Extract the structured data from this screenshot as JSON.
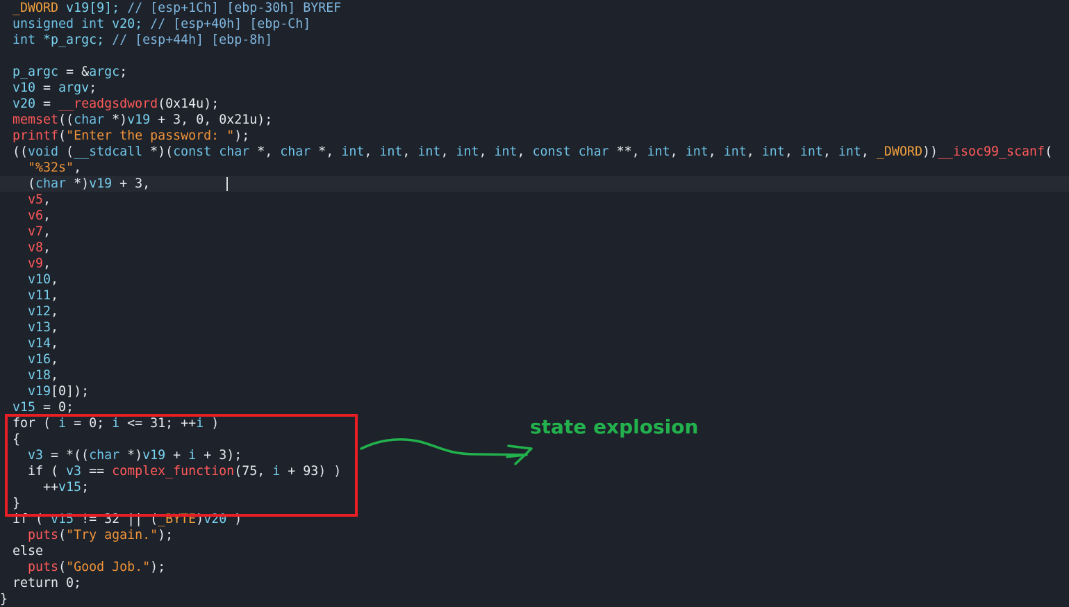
{
  "colors": {
    "background": "#1e222a",
    "highlight_box": "#e81e25",
    "annotation": "#22b14c"
  },
  "lines": [
    {
      "tokens": [
        {
          "t": "_DWORD",
          "c": "glob"
        },
        {
          "t": " v19[9]; ",
          "c": "var"
        },
        {
          "t": "// [esp+1Ch] [ebp-30h] BYREF",
          "c": "com"
        }
      ]
    },
    {
      "tokens": [
        {
          "t": "unsigned int",
          "c": "type"
        },
        {
          "t": " v20; ",
          "c": "var"
        },
        {
          "t": "// [esp+40h] [ebp-Ch]",
          "c": "com"
        }
      ]
    },
    {
      "tokens": [
        {
          "t": "int",
          "c": "type"
        },
        {
          "t": " *p_argc; ",
          "c": "var"
        },
        {
          "t": "// [esp+44h] [ebp-8h]",
          "c": "com"
        }
      ]
    },
    {
      "tokens": []
    },
    {
      "tokens": [
        {
          "t": "p_argc",
          "c": "var"
        },
        {
          "t": " = &",
          "c": "plain"
        },
        {
          "t": "argc",
          "c": "var"
        },
        {
          "t": ";",
          "c": "plain"
        }
      ]
    },
    {
      "tokens": [
        {
          "t": "v10",
          "c": "var"
        },
        {
          "t": " = ",
          "c": "plain"
        },
        {
          "t": "argv",
          "c": "var"
        },
        {
          "t": ";",
          "c": "plain"
        }
      ]
    },
    {
      "tokens": [
        {
          "t": "v20",
          "c": "var"
        },
        {
          "t": " = ",
          "c": "plain"
        },
        {
          "t": "__readgsdword",
          "c": "func"
        },
        {
          "t": "(0x14u);",
          "c": "plain"
        }
      ]
    },
    {
      "tokens": [
        {
          "t": "memset",
          "c": "func"
        },
        {
          "t": "((",
          "c": "plain"
        },
        {
          "t": "char",
          "c": "type"
        },
        {
          "t": " *)",
          "c": "plain"
        },
        {
          "t": "v19",
          "c": "var"
        },
        {
          "t": " + 3, 0, 0x21u);",
          "c": "plain"
        }
      ]
    },
    {
      "tokens": [
        {
          "t": "printf",
          "c": "func"
        },
        {
          "t": "(",
          "c": "plain"
        },
        {
          "t": "\"Enter the password: \"",
          "c": "str"
        },
        {
          "t": ");",
          "c": "plain"
        }
      ]
    },
    {
      "tokens": [
        {
          "t": "((",
          "c": "plain"
        },
        {
          "t": "void",
          "c": "type"
        },
        {
          "t": " (",
          "c": "plain"
        },
        {
          "t": "__stdcall",
          "c": "type"
        },
        {
          "t": " *)(",
          "c": "plain"
        },
        {
          "t": "const char",
          "c": "type"
        },
        {
          "t": " *, ",
          "c": "plain"
        },
        {
          "t": "char",
          "c": "type"
        },
        {
          "t": " *, ",
          "c": "plain"
        },
        {
          "t": "int",
          "c": "type"
        },
        {
          "t": ", ",
          "c": "plain"
        },
        {
          "t": "int",
          "c": "type"
        },
        {
          "t": ", ",
          "c": "plain"
        },
        {
          "t": "int",
          "c": "type"
        },
        {
          "t": ", ",
          "c": "plain"
        },
        {
          "t": "int",
          "c": "type"
        },
        {
          "t": ", ",
          "c": "plain"
        },
        {
          "t": "int",
          "c": "type"
        },
        {
          "t": ", ",
          "c": "plain"
        },
        {
          "t": "const char",
          "c": "type"
        },
        {
          "t": " **, ",
          "c": "plain"
        },
        {
          "t": "int",
          "c": "type"
        },
        {
          "t": ", ",
          "c": "plain"
        },
        {
          "t": "int",
          "c": "type"
        },
        {
          "t": ", ",
          "c": "plain"
        },
        {
          "t": "int",
          "c": "type"
        },
        {
          "t": ", ",
          "c": "plain"
        },
        {
          "t": "int",
          "c": "type"
        },
        {
          "t": ", ",
          "c": "plain"
        },
        {
          "t": "int",
          "c": "type"
        },
        {
          "t": ", ",
          "c": "plain"
        },
        {
          "t": "int",
          "c": "type"
        },
        {
          "t": ", ",
          "c": "plain"
        },
        {
          "t": "_DWORD",
          "c": "glob"
        },
        {
          "t": "))",
          "c": "plain"
        },
        {
          "t": "__isoc99_scanf",
          "c": "func"
        },
        {
          "t": "(",
          "c": "plain"
        }
      ]
    },
    {
      "tokens": [
        {
          "t": "  ",
          "c": "plain"
        },
        {
          "t": "\"%32s\"",
          "c": "str"
        },
        {
          "t": ",",
          "c": "plain"
        }
      ]
    },
    {
      "current": true,
      "tokens": [
        {
          "t": "  (",
          "c": "plain"
        },
        {
          "t": "char",
          "c": "type"
        },
        {
          "t": " *)",
          "c": "plain"
        },
        {
          "t": "v19",
          "c": "var"
        },
        {
          "t": " + 3,",
          "c": "plain"
        }
      ]
    },
    {
      "tokens": [
        {
          "t": "  ",
          "c": "plain"
        },
        {
          "t": "v5",
          "c": "arg"
        },
        {
          "t": ",",
          "c": "plain"
        }
      ]
    },
    {
      "tokens": [
        {
          "t": "  ",
          "c": "plain"
        },
        {
          "t": "v6",
          "c": "arg"
        },
        {
          "t": ",",
          "c": "plain"
        }
      ]
    },
    {
      "tokens": [
        {
          "t": "  ",
          "c": "plain"
        },
        {
          "t": "v7",
          "c": "arg"
        },
        {
          "t": ",",
          "c": "plain"
        }
      ]
    },
    {
      "tokens": [
        {
          "t": "  ",
          "c": "plain"
        },
        {
          "t": "v8",
          "c": "arg"
        },
        {
          "t": ",",
          "c": "plain"
        }
      ]
    },
    {
      "tokens": [
        {
          "t": "  ",
          "c": "plain"
        },
        {
          "t": "v9",
          "c": "arg"
        },
        {
          "t": ",",
          "c": "plain"
        }
      ]
    },
    {
      "tokens": [
        {
          "t": "  ",
          "c": "plain"
        },
        {
          "t": "v10",
          "c": "var"
        },
        {
          "t": ",",
          "c": "plain"
        }
      ]
    },
    {
      "tokens": [
        {
          "t": "  ",
          "c": "plain"
        },
        {
          "t": "v11",
          "c": "var"
        },
        {
          "t": ",",
          "c": "plain"
        }
      ]
    },
    {
      "tokens": [
        {
          "t": "  ",
          "c": "plain"
        },
        {
          "t": "v12",
          "c": "var"
        },
        {
          "t": ",",
          "c": "plain"
        }
      ]
    },
    {
      "tokens": [
        {
          "t": "  ",
          "c": "plain"
        },
        {
          "t": "v13",
          "c": "var"
        },
        {
          "t": ",",
          "c": "plain"
        }
      ]
    },
    {
      "tokens": [
        {
          "t": "  ",
          "c": "plain"
        },
        {
          "t": "v14",
          "c": "var"
        },
        {
          "t": ",",
          "c": "plain"
        }
      ]
    },
    {
      "tokens": [
        {
          "t": "  ",
          "c": "plain"
        },
        {
          "t": "v16",
          "c": "var"
        },
        {
          "t": ",",
          "c": "plain"
        }
      ]
    },
    {
      "tokens": [
        {
          "t": "  ",
          "c": "plain"
        },
        {
          "t": "v18",
          "c": "var"
        },
        {
          "t": ",",
          "c": "plain"
        }
      ]
    },
    {
      "tokens": [
        {
          "t": "  ",
          "c": "plain"
        },
        {
          "t": "v19",
          "c": "var"
        },
        {
          "t": "[0]);",
          "c": "plain"
        }
      ]
    },
    {
      "tokens": [
        {
          "t": "v15",
          "c": "var"
        },
        {
          "t": " = 0;",
          "c": "plain"
        }
      ]
    },
    {
      "tokens": [
        {
          "t": "for ( ",
          "c": "plain"
        },
        {
          "t": "i",
          "c": "var"
        },
        {
          "t": " = 0; ",
          "c": "plain"
        },
        {
          "t": "i",
          "c": "var"
        },
        {
          "t": " <= 31; ++",
          "c": "plain"
        },
        {
          "t": "i",
          "c": "var"
        },
        {
          "t": " )",
          "c": "plain"
        }
      ]
    },
    {
      "tokens": [
        {
          "t": "{",
          "c": "plain"
        }
      ]
    },
    {
      "tokens": [
        {
          "t": "  ",
          "c": "plain"
        },
        {
          "t": "v3",
          "c": "var"
        },
        {
          "t": " = *((",
          "c": "plain"
        },
        {
          "t": "char",
          "c": "type"
        },
        {
          "t": " *)",
          "c": "plain"
        },
        {
          "t": "v19",
          "c": "var"
        },
        {
          "t": " + ",
          "c": "plain"
        },
        {
          "t": "i",
          "c": "var"
        },
        {
          "t": " + 3);",
          "c": "plain"
        }
      ]
    },
    {
      "tokens": [
        {
          "t": "  if ( ",
          "c": "plain"
        },
        {
          "t": "v3",
          "c": "var"
        },
        {
          "t": " == ",
          "c": "plain"
        },
        {
          "t": "complex_function",
          "c": "func"
        },
        {
          "t": "(75, ",
          "c": "plain"
        },
        {
          "t": "i",
          "c": "var"
        },
        {
          "t": " + 93) )",
          "c": "plain"
        }
      ]
    },
    {
      "tokens": [
        {
          "t": "    ++",
          "c": "plain"
        },
        {
          "t": "v15",
          "c": "var"
        },
        {
          "t": ";",
          "c": "plain"
        }
      ]
    },
    {
      "tokens": [
        {
          "t": "}",
          "c": "plain"
        }
      ]
    },
    {
      "tokens": [
        {
          "t": "if ( ",
          "c": "plain"
        },
        {
          "t": "v15",
          "c": "var"
        },
        {
          "t": " != 32 || (",
          "c": "plain"
        },
        {
          "t": "_BYTE",
          "c": "glob"
        },
        {
          "t": ")",
          "c": "plain"
        },
        {
          "t": "v20",
          "c": "var"
        },
        {
          "t": " )",
          "c": "plain"
        }
      ]
    },
    {
      "tokens": [
        {
          "t": "  ",
          "c": "plain"
        },
        {
          "t": "puts",
          "c": "func"
        },
        {
          "t": "(",
          "c": "plain"
        },
        {
          "t": "\"Try again.\"",
          "c": "str"
        },
        {
          "t": ");",
          "c": "plain"
        }
      ]
    },
    {
      "tokens": [
        {
          "t": "else",
          "c": "plain"
        }
      ]
    },
    {
      "tokens": [
        {
          "t": "  ",
          "c": "plain"
        },
        {
          "t": "puts",
          "c": "func"
        },
        {
          "t": "(",
          "c": "plain"
        },
        {
          "t": "\"Good Job.\"",
          "c": "str"
        },
        {
          "t": ");",
          "c": "plain"
        }
      ]
    },
    {
      "tokens": [
        {
          "t": "return 0;",
          "c": "plain"
        }
      ]
    },
    {
      "tokens": [
        {
          "t": "}",
          "c": "plain"
        }
      ]
    }
  ],
  "annotation": {
    "label": "state explosion"
  }
}
